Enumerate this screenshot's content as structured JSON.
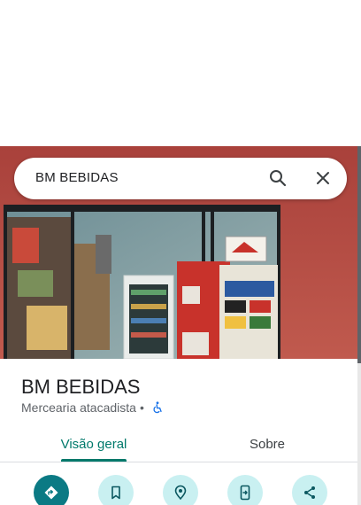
{
  "search": {
    "query": "BM BEBIDAS"
  },
  "place": {
    "name": "BM BEBIDAS",
    "category": "Mercearia atacadista",
    "separator": "•"
  },
  "tabs": [
    {
      "label": "Visão geral",
      "selected": true
    },
    {
      "label": "Sobre",
      "selected": false
    }
  ],
  "actions": [
    {
      "icon": "directions-icon"
    },
    {
      "icon": "save-icon"
    },
    {
      "icon": "nearby-icon"
    },
    {
      "icon": "send-to-phone-icon"
    },
    {
      "icon": "share-icon"
    }
  ],
  "colors": {
    "accent": "#00796b",
    "primary_action": "#0b7a84",
    "action_bg": "#c9f0f1",
    "photo_wall": "#b04a42"
  }
}
